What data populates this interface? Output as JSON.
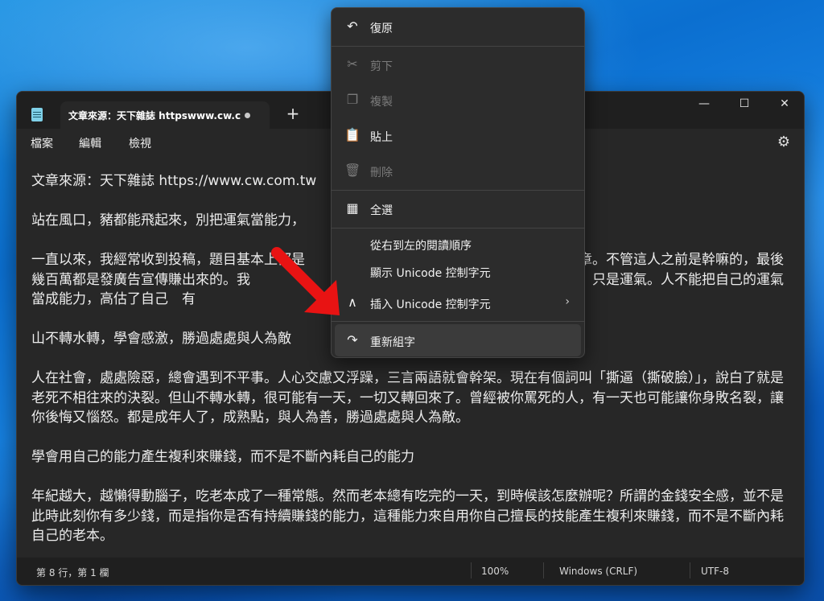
{
  "window": {
    "tab_title": "文章來源：天下雜誌 httpswww.cw.c",
    "new_tab_label": "+",
    "minimize_glyph": "—",
    "maximize_glyph": "☐",
    "close_glyph": "✕"
  },
  "menubar": {
    "items": [
      "檔案",
      "編輯",
      "檢視"
    ],
    "settings_icon": "gear-icon"
  },
  "document": {
    "paragraphs": [
      "文章來源：天下雜誌 https://www.cw.com.tw",
      "站在風口，豬都能飛起來，別把運氣當能力，",
      "一直以來，我經常收到投稿，題目基本上都是　　　　　　　　　　　　　　　　　類的文章。不管這人之前是幹嘛的，最後幾百萬都是發廣告宣傳賺出來的。我　　　　　　　　　　　　　　　　　值得標榜的能力，只是運氣。人不能把自己的運氣當成能力，高估了自己　有　　　　　　　　　　　　　　　　　才是你真正的能力所在。",
      "山不轉水轉，學會感激，勝過處處與人為敵",
      "人在社會，處處險惡，總會遇到不平事。人心交慮又浮躁，三言兩語就會幹架。現在有個詞叫「撕逼（撕破臉）」，說白了就是老死不相往來的決裂。但山不轉水轉，很可能有一天，一切又轉回來了。曾經被你罵死的人，有一天也可能讓你身敗名裂，讓你後悔又惱怒。都是成年人了，成熟點，與人為善，勝過處處與人為敵。",
      "學會用自己的能力產生複利來賺錢，而不是不斷內耗自己的能力",
      "年紀越大，越懶得動腦子，吃老本成了一種常態。然而老本總有吃完的一天，到時候該怎麼辦呢？所謂的金錢安全感，並不是此時此刻你有多少錢，而是指你是否有持續賺錢的能力，這種能力來自用你自己擅長的技能產生複利來賺錢，而不是不斷內耗自己的老本。"
    ]
  },
  "statusbar": {
    "position": "第 8 行，第 1 欄",
    "zoom": "100%",
    "line_ending": "Windows (CRLF)",
    "encoding": "UTF-8"
  },
  "context_menu": {
    "items": [
      {
        "label": "復原",
        "icon": "undo-icon",
        "enabled": true
      },
      {
        "label": "剪下",
        "icon": "cut-icon",
        "enabled": false
      },
      {
        "label": "複製",
        "icon": "copy-icon",
        "enabled": false
      },
      {
        "label": "貼上",
        "icon": "paste-icon",
        "enabled": true
      },
      {
        "label": "刪除",
        "icon": "delete-icon",
        "enabled": false
      },
      {
        "label": "全選",
        "icon": "select-all-icon",
        "enabled": true
      },
      {
        "label": "從右到左的閱讀順序",
        "enabled": true
      },
      {
        "label": "顯示 Unicode 控制字元",
        "enabled": true
      },
      {
        "label": "插入 Unicode 控制字元",
        "icon": "insert-icon",
        "enabled": true,
        "has_submenu": true
      },
      {
        "label": "重新組字",
        "icon": "reconvert-icon",
        "enabled": true,
        "highlighted": true
      }
    ]
  },
  "annotation": {
    "arrow_color": "#e81313"
  }
}
